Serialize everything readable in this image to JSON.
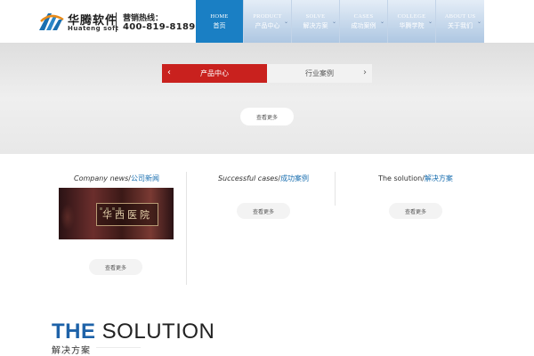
{
  "header": {
    "brand_cn": "华腾软件",
    "brand_en": "Huateng soft",
    "hotline_label": "营销热线：",
    "hotline_number": "400-819-8189"
  },
  "nav": {
    "items": [
      {
        "en": "HOME",
        "cn": "首页",
        "active": true
      },
      {
        "en": "PRODUCT",
        "cn": "产品中心"
      },
      {
        "en": "SOLVE",
        "cn": "解决方案"
      },
      {
        "en": "CASES",
        "cn": "成功案例"
      },
      {
        "en": "COLLEGE",
        "cn": "华腾学院"
      },
      {
        "en": "ABOUT US",
        "cn": "关于我们"
      }
    ]
  },
  "tabs": {
    "products": "产品中心",
    "cases": "行业案例"
  },
  "band": {
    "more_label": "查看更多"
  },
  "columns": {
    "news": {
      "title_en": "Company news",
      "title_cn": "公司新闻",
      "more_label": "查看更多",
      "image_text": "华西医院"
    },
    "cases": {
      "title_en": "Successful cases",
      "title_cn": "成功案例",
      "more_label": "查看更多"
    },
    "solution": {
      "title_en": "The solution",
      "title_cn": "解决方案",
      "more_label": "查看更多"
    }
  },
  "solution_heading": {
    "the": "THE",
    "solution": "SOLUTION",
    "cn": "解决方案"
  },
  "colors": {
    "accent_red": "#c9211e",
    "accent_blue": "#1a7fc4",
    "title_blue": "#1e62a8"
  }
}
